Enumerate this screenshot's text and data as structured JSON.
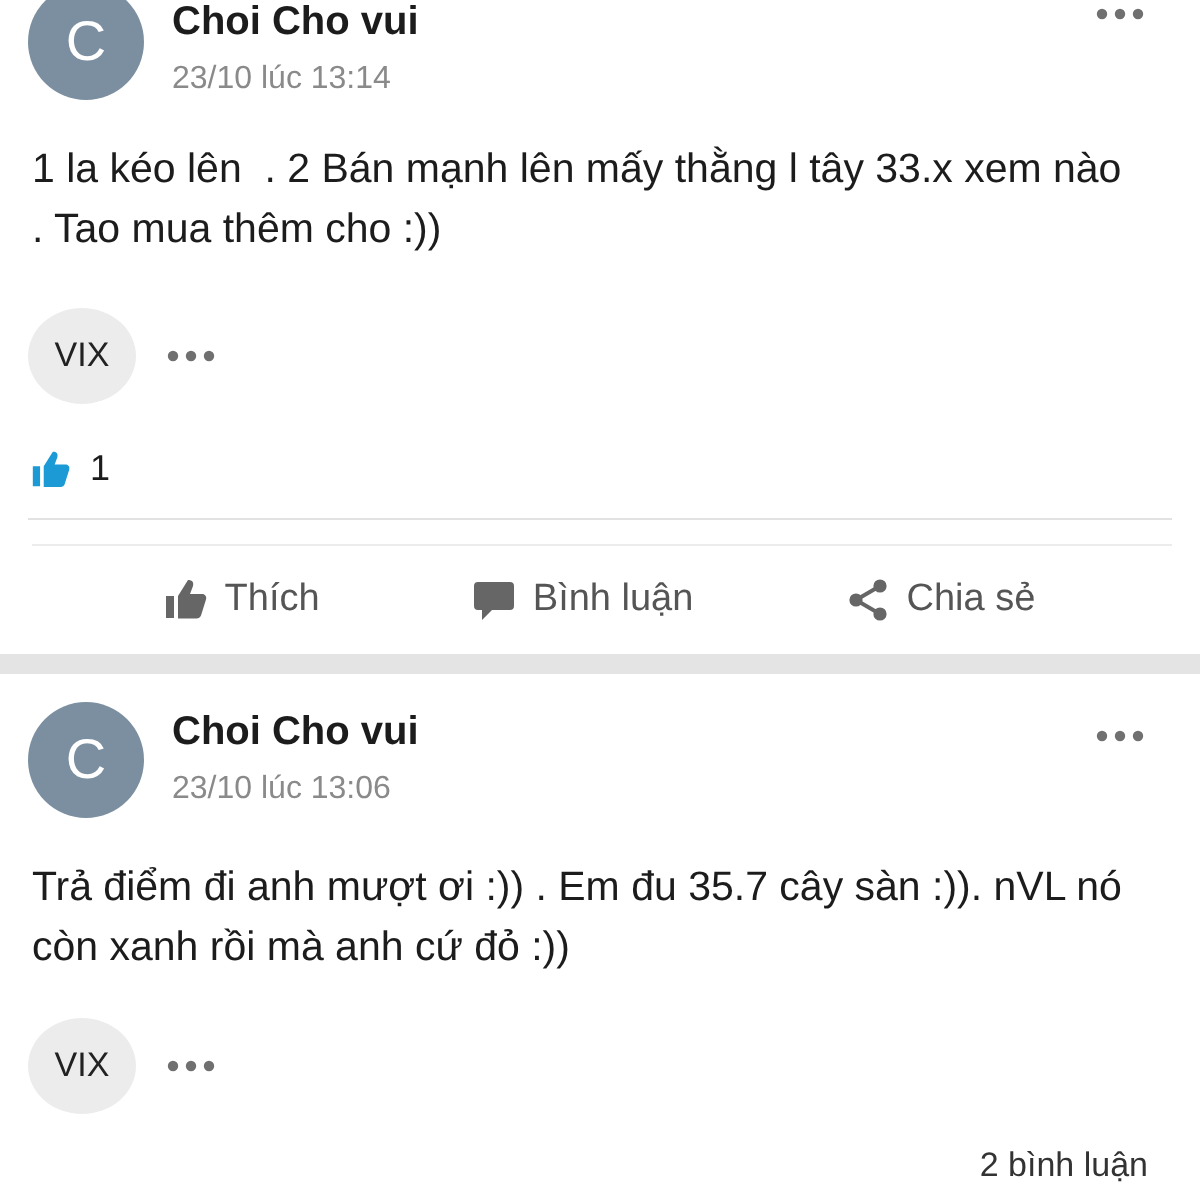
{
  "posts": [
    {
      "author": "Choi Cho vui",
      "avatar_letter": "C",
      "time": "23/10 lúc 13:14",
      "text": "1 la kéo lên  . 2 Bán mạnh lên mấy thằng l tây 33.x xem nào . Tao mua thêm cho :))",
      "tag": "VIX",
      "likes": "1",
      "actions": [
        {
          "kind": "like",
          "label": "Thích"
        },
        {
          "kind": "comment",
          "label": "Bình luận"
        },
        {
          "kind": "share",
          "label": "Chia sẻ"
        }
      ]
    },
    {
      "author": "Choi Cho vui",
      "avatar_letter": "C",
      "time": "23/10 lúc 13:06",
      "text": "Trả điểm đi anh mượt ơi :)) . Em đu 35.7 cây sàn :)). nVL nó còn xanh rồi mà anh cứ đỏ :))",
      "tag": "VIX",
      "comments": "2 bình luận"
    }
  ]
}
